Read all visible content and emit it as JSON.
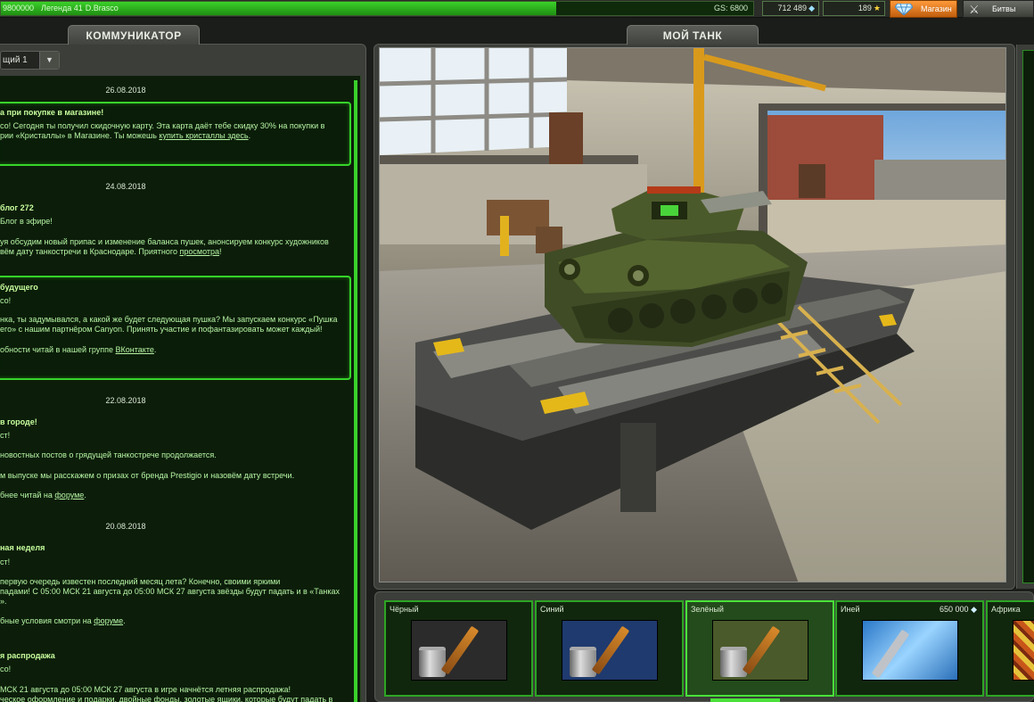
{
  "topbar": {
    "xp_value": "9800000",
    "rank": "Легенда 41",
    "username": "D.Brasco",
    "gs_label": "GS: 6800",
    "xp_progress": 0.738,
    "crystals": "712 489",
    "stars": "189",
    "shop_label": "Магазин",
    "battles_label": "Битвы"
  },
  "communicator": {
    "tab_label": "КОММУНИКАТОР",
    "dropdown_value": "щий 1",
    "news": [
      {
        "date": "26.08.2018",
        "highlighted": true,
        "title": "а при покупке в магазине!",
        "lines": [
          "со! Сегодня ты получил скидочную карту. Эта карта даёт тебе скидку 30% на покупки в",
          "рии «Кристаллы» в Магазине. Ты можешь"
        ],
        "link": "купить кристаллы здесь",
        "link_tail": "."
      },
      {
        "date": "24.08.2018",
        "title": "блог 272",
        "greeting": "Блог в эфире!",
        "lines": [
          "уя обсудим новый припас и изменение баланса пушек, анонсируем конкурс художников",
          "вём дату танкостречи в Краснодаре. Приятного"
        ],
        "link": "просмотра",
        "link_tail": "!"
      },
      {
        "highlighted": true,
        "title": "будущего",
        "greeting": "со!",
        "lines": [
          "нка, ты задумывался, а какой же будет следующая пушка? Мы запускаем конкурс «Пушка",
          "его» с нашим партнёром Canyon. Принять участие и пофантазировать может каждый!"
        ],
        "extra": "обности читай в нашей группе",
        "link": "ВКонтакте",
        "link_tail": "."
      },
      {
        "date": "22.08.2018",
        "title": "в городе!",
        "greeting": "ст!",
        "lines": [
          "новостных постов о грядущей танкостречe продолжается.",
          "м выпуске мы расскажем о призах от бренда Prestigio и назовём дату встречи."
        ],
        "extra": "бнее читай на",
        "link": "форуме",
        "link_tail": "."
      },
      {
        "date": "20.08.2018",
        "title": "ная неделя",
        "greeting": "ст!",
        "lines": [
          "первую очередь известен последний месяц лета? Конечно, своими яркими",
          "падами! С 05:00 МСК 21 августа до 05:00 МСК 27 августа звёзды будут падать и в «Танках",
          "»."
        ],
        "extra": "бные условия смотри на",
        "link": "форуме",
        "link_tail": "."
      },
      {
        "title": "я распродажа",
        "greeting": "со!",
        "lines": [
          "МСК 21 августа до 05:00 МСК 27 августа в игре начнётся летняя распродажа!",
          "ческое оформление и подарки, двойные фонды, золотые ящики, которые будут падать в"
        ]
      }
    ]
  },
  "garage": {
    "tab_label": "МОЙ ТАНК"
  },
  "paints": [
    {
      "name": "Чёрный",
      "price": "",
      "color": "#2a2a2a"
    },
    {
      "name": "Синий",
      "price": "",
      "color": "#1f3a6e"
    },
    {
      "name": "Зелёный",
      "price": "",
      "color": "#4a5a2a"
    },
    {
      "name": "Иней",
      "price": "650 000",
      "color": "#5fb0e8"
    },
    {
      "name": "Африка",
      "price": "",
      "color": "#b8501a"
    }
  ]
}
